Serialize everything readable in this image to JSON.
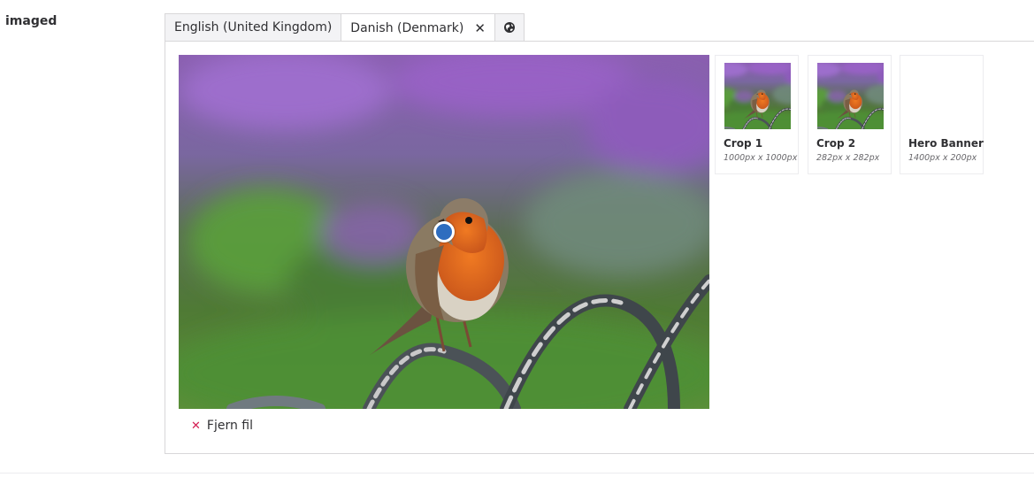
{
  "property": {
    "label": "imaged"
  },
  "tabs": [
    {
      "label": "English (United Kingdom)"
    },
    {
      "label": "Danish (Denmark)",
      "close_icon": "close-icon"
    }
  ],
  "globe_icon": "globe-icon",
  "crops": [
    {
      "name": "Crop 1",
      "dims": "1000px x 1000px"
    },
    {
      "name": "Crop 2",
      "dims": "282px x 282px"
    },
    {
      "name": "Hero Banner",
      "dims": "1400px x 200px"
    }
  ],
  "actions": {
    "remove_label": "Fjern fil"
  },
  "colors": {
    "focal_point": "#2e6dbf",
    "remove_icon": "#d42054"
  }
}
